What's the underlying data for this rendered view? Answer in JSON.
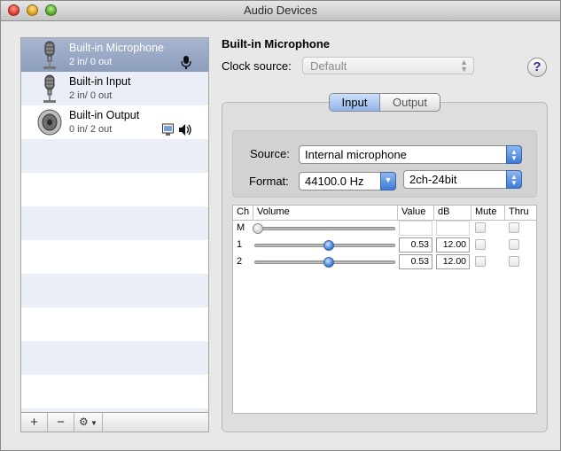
{
  "window": {
    "title": "Audio Devices"
  },
  "devices": [
    {
      "name": "Built-in Microphone",
      "channels": "2 in/ 0 out",
      "icon": "microphone-icon",
      "selected": true
    },
    {
      "name": "Built-in Input",
      "channels": "2 in/ 0 out",
      "icon": "microphone-icon",
      "selected": false
    },
    {
      "name": "Built-in Output",
      "channels": "0 in/ 2 out",
      "icon": "speaker-icon",
      "selected": false
    }
  ],
  "list_toolbar": {
    "add": "+",
    "remove": "−",
    "gear": "gear-icon"
  },
  "detail": {
    "device_title": "Built-in Microphone",
    "clock_source_label": "Clock source:",
    "clock_source_value": "Default",
    "help": "?",
    "tabs": [
      {
        "label": "Input",
        "active": true
      },
      {
        "label": "Output",
        "active": false
      }
    ],
    "source_label": "Source:",
    "source_value": "Internal microphone",
    "format_label": "Format:",
    "format_rate": "44100.0 Hz",
    "format_bits": "2ch-24bit"
  },
  "channel_table": {
    "headers": {
      "ch": "Ch",
      "volume": "Volume",
      "value": "Value",
      "db": "dB",
      "mute": "Mute",
      "thru": "Thru"
    },
    "rows": [
      {
        "ch": "M",
        "volume": 0,
        "value": "",
        "db": "",
        "mute": false,
        "thru": false
      },
      {
        "ch": "1",
        "volume": 0.53,
        "value": "0.53",
        "db": "12.00",
        "mute": false,
        "thru": false
      },
      {
        "ch": "2",
        "volume": 0.53,
        "value": "0.53",
        "db": "12.00",
        "mute": false,
        "thru": false
      }
    ]
  },
  "colors": {
    "selection": "#8c9dbc",
    "accent": "#3c7ad8"
  }
}
